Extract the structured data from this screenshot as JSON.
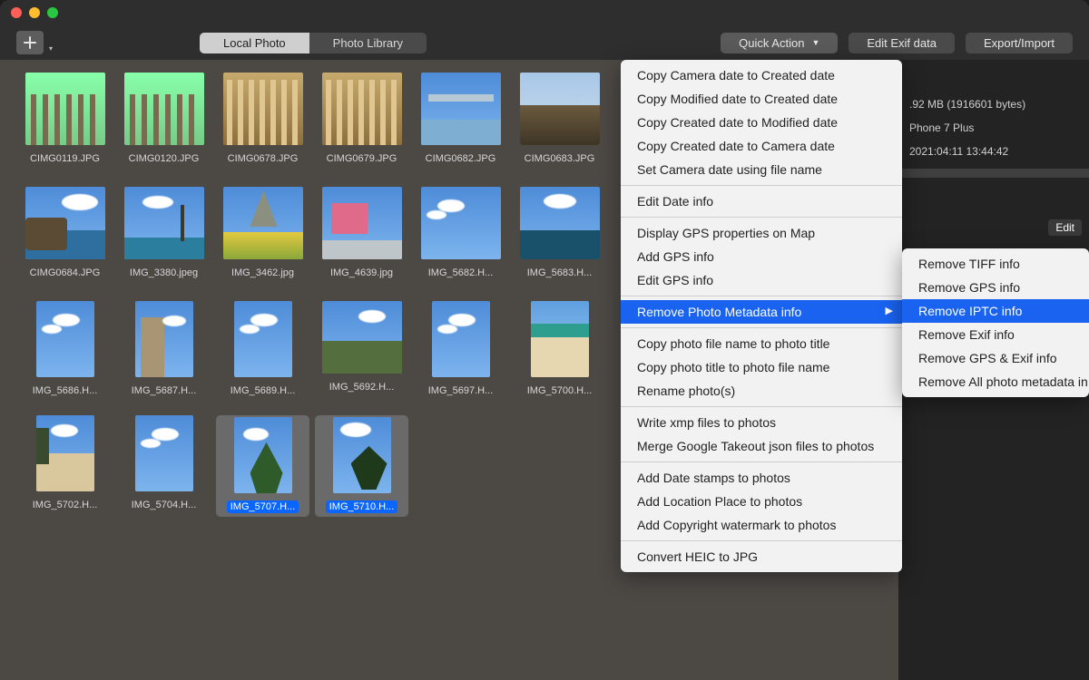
{
  "toolbar": {
    "seg_local": "Local Photo",
    "seg_library": "Photo Library",
    "quick_action": "Quick Action",
    "edit_exif": "Edit Exif data",
    "export_import": "Export/Import"
  },
  "sidebar": {
    "size": ".92 MB (1916601 bytes)",
    "device": "Phone 7 Plus",
    "date": "2021:04:11 13:44:42",
    "edit": "Edit"
  },
  "grid": {
    "items": [
      {
        "label": "CIMG0119.JPG",
        "orient": "l",
        "art": "pillars"
      },
      {
        "label": "CIMG0120.JPG",
        "orient": "l",
        "art": "pillars"
      },
      {
        "label": "CIMG0678.JPG",
        "orient": "l",
        "art": "colonnade"
      },
      {
        "label": "CIMG0679.JPG",
        "orient": "l",
        "art": "colonnade"
      },
      {
        "label": "CIMG0682.JPG",
        "orient": "l",
        "art": "bridge"
      },
      {
        "label": "CIMG0683.JPG",
        "orient": "l",
        "art": "hut"
      },
      {
        "label": "CIMG0684.JPG",
        "orient": "l",
        "art": "lagoon"
      },
      {
        "label": "IMG_3380.jpeg",
        "orient": "l",
        "art": "palms"
      },
      {
        "label": "IMG_3462.jpg",
        "orient": "l",
        "art": "field"
      },
      {
        "label": "IMG_4639.jpg",
        "orient": "l",
        "art": "pink"
      },
      {
        "label": "IMG_5682.H...",
        "orient": "l",
        "art": "sky"
      },
      {
        "label": "IMG_5683.H...",
        "orient": "l",
        "art": "pool"
      },
      {
        "label": "IMG_5686.H...",
        "orient": "p",
        "art": "sky"
      },
      {
        "label": "IMG_5687.H...",
        "orient": "p",
        "art": "tower"
      },
      {
        "label": "IMG_5689.H...",
        "orient": "p",
        "art": "sky"
      },
      {
        "label": "IMG_5692.H...",
        "orient": "l",
        "art": "lawn"
      },
      {
        "label": "IMG_5697.H...",
        "orient": "p",
        "art": "sky"
      },
      {
        "label": "IMG_5700.H...",
        "orient": "p",
        "art": "beach"
      },
      {
        "label": "IMG_5702.H...",
        "orient": "p",
        "art": "beach2"
      },
      {
        "label": "IMG_5704.H...",
        "orient": "p",
        "art": "sky"
      },
      {
        "label": "IMG_5707.H...",
        "orient": "p",
        "art": "palm2",
        "selected": true
      },
      {
        "label": "IMG_5710.H...",
        "orient": "p",
        "art": "leaf",
        "selected": true
      }
    ]
  },
  "quick_action_menu": {
    "groups": [
      [
        "Copy Camera date to Created date",
        "Copy Modified date to Created date",
        "Copy Created date to Modified date",
        "Copy Created date to Camera date",
        "Set Camera date using file name"
      ],
      [
        "Edit Date info"
      ],
      [
        "Display GPS properties on Map",
        "Add GPS info",
        "Edit GPS  info"
      ],
      [
        {
          "label": "Remove Photo Metadata info",
          "submenu": true,
          "highlight": true
        }
      ],
      [
        "Copy photo file name to photo title",
        "Copy photo title to photo file name",
        "Rename photo(s)"
      ],
      [
        "Write xmp files to photos",
        "Merge Google Takeout json files to photos"
      ],
      [
        "Add Date stamps to photos",
        "Add Location Place to photos",
        "Add Copyright watermark to photos"
      ],
      [
        "Convert HEIC to JPG"
      ]
    ]
  },
  "remove_metadata_submenu": {
    "items": [
      {
        "label": "Remove TIFF info"
      },
      {
        "label": "Remove GPS info"
      },
      {
        "label": "Remove IPTC info",
        "highlight": true
      },
      {
        "label": "Remove Exif info"
      },
      {
        "label": "Remove GPS & Exif info"
      },
      {
        "label": "Remove All photo metadata in"
      }
    ]
  }
}
